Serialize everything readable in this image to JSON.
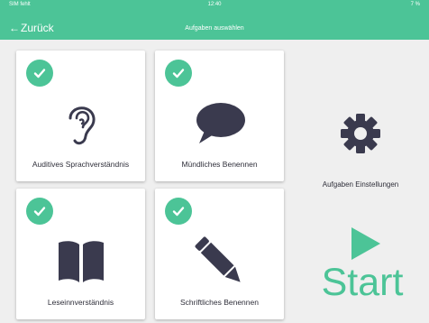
{
  "status_bar": {
    "carrier": "SIM fehlt",
    "time": "12:40",
    "battery": "7 %"
  },
  "nav": {
    "back_label": "Zurück",
    "title": "Aufgaben auswählen"
  },
  "tiles": [
    {
      "label": "Auditives Sprachverständnis",
      "icon": "ear-icon",
      "completed": true
    },
    {
      "label": "Mündliches Benennen",
      "icon": "speech-bubble-icon",
      "completed": true
    },
    {
      "label": "Leseinnverständnis",
      "icon": "book-icon",
      "completed": true
    },
    {
      "label": "Schriftliches Benennen",
      "icon": "pencil-icon",
      "completed": true
    }
  ],
  "settings": {
    "label": "Aufgaben Einstellungen",
    "icon": "gear-icon"
  },
  "start": {
    "label": "Start",
    "icon": "play-icon"
  },
  "colors": {
    "accent": "#4cc497",
    "icon_dark": "#3a3a4e",
    "background": "#efefef"
  }
}
